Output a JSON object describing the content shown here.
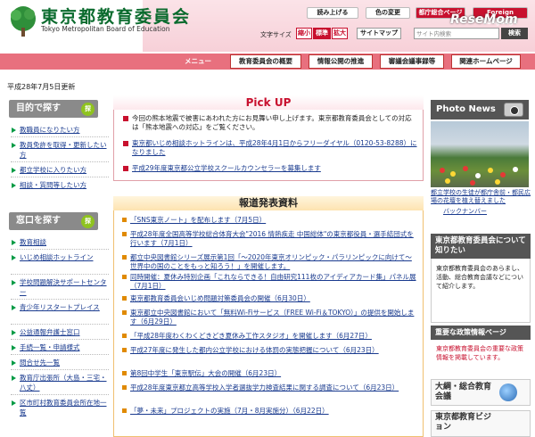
{
  "header": {
    "org_name_jp": "東京都教育委員会",
    "org_name_en": "Tokyo Metropolitan Board of Education",
    "read_aloud": "読み上げる",
    "color_change": "色の変更",
    "other_langs": "都庁総合ページ",
    "english": "Foreign Language",
    "resemom": "ReseMom",
    "font_size_label": "文字サイズ",
    "font_small": "縮小",
    "font_standard": "標準",
    "font_large": "拡大",
    "sitemap": "サイトマップ",
    "search_placeholder": "サイト内検索",
    "search_button": "検索"
  },
  "nav": {
    "menu": "メニュー",
    "tabs": [
      "教育委員会の概要",
      "情報公開の推進",
      "審議会議事録等",
      "関連ホームページ"
    ]
  },
  "update_date": "平成28年7月5日更新",
  "left": {
    "purpose_title": "目的で探す",
    "purpose_items": [
      "教職員になりたい方",
      "教員免許を取得・更新したい方",
      "都立学校に入りたい方",
      "相談・質問等したい方"
    ],
    "window_title": "窓口を探す",
    "window_items": [
      "教育相談",
      "いじめ相談ホットライン",
      "学校問題解決サポートセンター",
      "青少年リスタートプレイス",
      "公益通報弁護士窓口",
      "手続一覧・申請様式",
      "問合せ先一覧",
      "教育庁出張所（大島・三宅・八丈）",
      "区市町村教育委員会所在地一覧"
    ]
  },
  "pickup": {
    "title": "Pick UP",
    "items": [
      "今回の熊本地震で被害にあわれた方にお見舞い申し上げます。東京都教育委員会としての対応は「熊本地震への対応」をご覧ください。",
      "東京都いじめ相談ホットラインは、平成28年4月1日からフリーダイヤル（0120-53-8288）になりました",
      "平成29年度東京都公立学校スクールカウンセラーを募集します"
    ]
  },
  "news": {
    "title": "報道発表資料",
    "items": [
      "「SNS東京ノート」を配布します（7月5日）",
      "平成28年度全国高等学校総合体育大会\"2016 情熱疾走 中国総体\"の東京都役員・選手結団式を行います（7月1日）",
      "都立中央図書館シリーズ展示第1回「〜2020年東京オリンピック・パラリンピックに向けて〜 世界中の国のことをもっと知ろう！」を開催します。",
      "同時開催：夏休み特別企画「これならできる！自由研究111枚のアイディアカード集」パネル展（7月1日）",
      "東京都教育委員会いじめ問題対策委員会の開催（6月30日）",
      "東京都立中央図書館において「無料Wi-Fiサービス（FREE Wi-Fi＆TOKYO）」の提供を開始します（6月29日）",
      "「平成28年度わくわくどきどき夏休み工作スタジオ」を開催します（6月27日）",
      "平成27年度に発生した都内公立学校における体罰の実態把握について（6月23日）",
      "第8回中学生「東京駅伝」大会の開催（6月23日）",
      "平成28年度東京都立高等学校入学者選抜学力検査結果に関する調査について（6月23日）",
      "「夢・未来」プロジェクトの実施（7月・8月実施分）（6月22日）"
    ]
  },
  "right": {
    "photo_news": "Photo News",
    "photo_caption": "都立学校の生徒が都庁舎前・都民広場の花壇を植え替えました",
    "back_number": "バックナンバー",
    "board_title": "東京都教育委員会について知りたい",
    "board_text": "東京都教育委員会のあらまし、活動、総合教育会議などについて紹介します。",
    "policy_title": "重要な政策情報ページ",
    "policy_text": "東京都教育委員会の重要な政策情報を掲載しています。",
    "taiko": "大綱・総合教育会議",
    "vision": "東京都教育ビジョン"
  },
  "colors": {
    "accent": "#c8102e",
    "nav": "#e8707e",
    "brand_green": "#0b6b2e"
  }
}
